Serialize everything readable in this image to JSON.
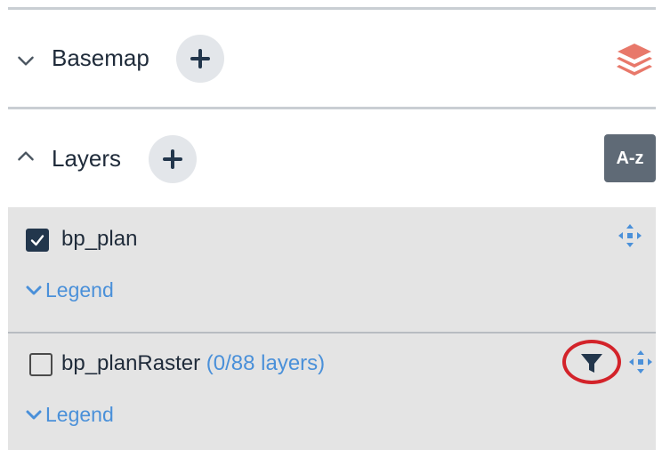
{
  "basemap": {
    "title": "Basemap",
    "expanded": false,
    "add_icon": "plus-icon",
    "layers_icon": "stacked-layers-icon",
    "layers_icon_color": "#e8786a"
  },
  "layers_section": {
    "title": "Layers",
    "expanded": true,
    "add_icon": "plus-icon",
    "sort_label": "A-z"
  },
  "layers": [
    {
      "name": "bp_plan",
      "count_text": "",
      "checked": true,
      "legend_label": "Legend",
      "has_filter": false
    },
    {
      "name": "bp_planRaster",
      "count_text": "(0/88 layers)",
      "checked": false,
      "legend_label": "Legend",
      "has_filter": true
    }
  ],
  "colors": {
    "accent_blue": "#4a90d9",
    "dark_navy": "#22364c",
    "highlight_red": "#d3232a",
    "panel_gray": "#e4e4e4"
  }
}
